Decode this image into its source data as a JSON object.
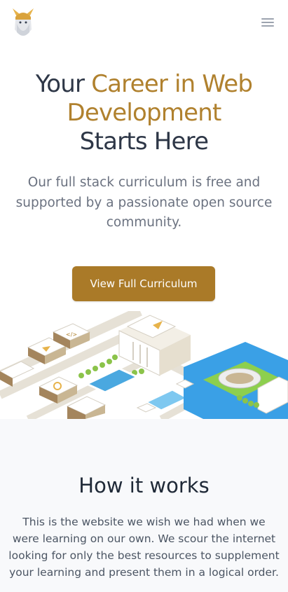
{
  "header": {
    "logo_icon": "odin-helmet-logo-icon",
    "menu_icon": "hamburger-menu-icon"
  },
  "hero": {
    "title_part1": "Your ",
    "title_accent": "Career in Web Development",
    "title_part2": "Starts Here",
    "subtitle": "Our full stack curriculum is free and supported by a passionate open source community.",
    "cta_label": "View Full Curriculum"
  },
  "how_it_works": {
    "title": "How it works",
    "text": "This is the website we wish we had when we were learning on our own. We scour the internet looking for only the best resources to supplement your learning and present them in a logical order."
  },
  "colors": {
    "accent": "#b0812e",
    "button": "#aa7a28",
    "heading": "#2e3747",
    "section_bg": "#f8f9fb"
  }
}
